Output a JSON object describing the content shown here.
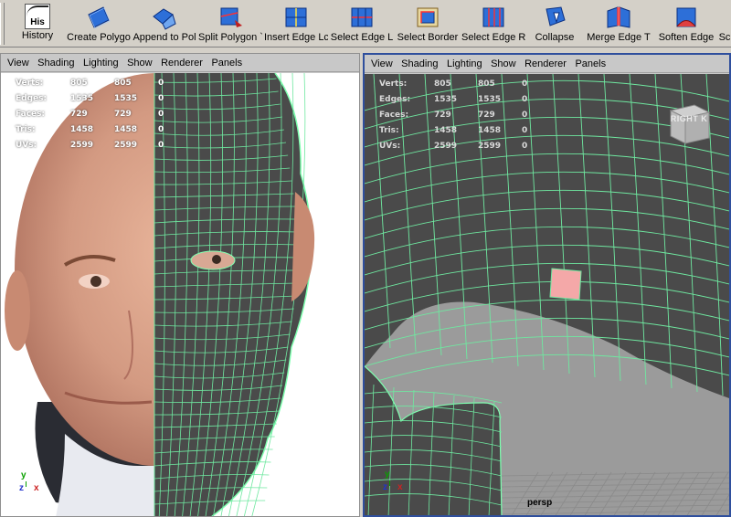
{
  "shelf": {
    "tools": [
      {
        "label": "History",
        "icon": "history-icon",
        "name": "history"
      },
      {
        "label": "Create Polygo",
        "icon": "create-polygon-icon",
        "name": "create-polygon"
      },
      {
        "label": "Append to Pol",
        "icon": "append-to-polygon-icon",
        "name": "append-to-polygon"
      },
      {
        "label": "Split Polygon `",
        "icon": "split-polygon-icon",
        "name": "split-polygon"
      },
      {
        "label": "Insert Edge Lc",
        "icon": "insert-edge-loop-icon",
        "name": "insert-edge-loop"
      },
      {
        "label": "Select Edge L",
        "icon": "select-edge-loop-icon",
        "name": "select-edge-loop"
      },
      {
        "label": "Select Border",
        "icon": "select-border-icon",
        "name": "select-border"
      },
      {
        "label": "Select Edge R",
        "icon": "select-edge-ring-icon",
        "name": "select-edge-ring"
      },
      {
        "label": "Collapse",
        "icon": "collapse-icon",
        "name": "collapse"
      },
      {
        "label": "Merge Edge T",
        "icon": "merge-edge-icon",
        "name": "merge-edge"
      },
      {
        "label": "Soften Edge",
        "icon": "soften-edge-icon",
        "name": "soften-edge"
      },
      {
        "label": "Sc",
        "icon": "sc-icon",
        "name": "sc"
      }
    ],
    "history_icon_text": "His"
  },
  "menu": [
    "View",
    "Shading",
    "Lighting",
    "Show",
    "Renderer",
    "Panels"
  ],
  "stats": [
    {
      "label": "Verts:",
      "a": "805",
      "b": "805",
      "c": "0"
    },
    {
      "label": "Edges:",
      "a": "1535",
      "b": "1535",
      "c": "0"
    },
    {
      "label": "Faces:",
      "a": "729",
      "b": "729",
      "c": "0"
    },
    {
      "label": "Tris:",
      "a": "1458",
      "b": "1458",
      "c": "0"
    },
    {
      "label": "UVs:",
      "a": "2599",
      "b": "2599",
      "c": "0"
    }
  ],
  "axis": {
    "y": "y",
    "z": "z",
    "x": "x"
  },
  "right_view": {
    "camera": "persp",
    "viewcube_label": "RIGHT",
    "viewcube_side": "K"
  },
  "colors": {
    "wireframe": "#7fffb0",
    "mesh_face": "#4a4a4a",
    "selected_face": "#f4a8a8",
    "active_panel_border": "#2f4f9d"
  }
}
